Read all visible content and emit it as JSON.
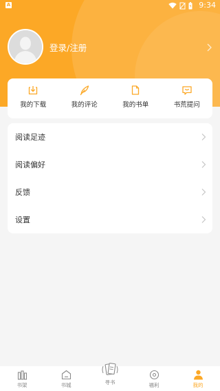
{
  "status_bar": {
    "app_badge": "A",
    "time": "9:34",
    "icons": [
      "wifi-icon",
      "no-sim-icon",
      "battery-icon"
    ]
  },
  "profile": {
    "login_label": "登录/注册"
  },
  "quick_actions": [
    {
      "label": "我的下载",
      "icon": "download-icon"
    },
    {
      "label": "我的评论",
      "icon": "feather-pen-icon"
    },
    {
      "label": "我的书单",
      "icon": "document-icon"
    },
    {
      "label": "书荒提问",
      "icon": "chat-bubble-icon"
    }
  ],
  "menu": [
    {
      "label": "阅读足迹"
    },
    {
      "label": "阅读偏好"
    },
    {
      "label": "反馈"
    },
    {
      "label": "设置"
    }
  ],
  "bottom_nav": [
    {
      "label": "书架",
      "icon": "bookshelf-icon"
    },
    {
      "label": "书城",
      "icon": "store-icon"
    },
    {
      "label": "寻书",
      "icon": "find-book-icon"
    },
    {
      "label": "福利",
      "icon": "coin-icon"
    },
    {
      "label": "我的",
      "icon": "user-icon"
    }
  ],
  "colors": {
    "accent": "#fca826",
    "background": "#f5f5f5",
    "nav_inactive": "#8a8a8a"
  }
}
